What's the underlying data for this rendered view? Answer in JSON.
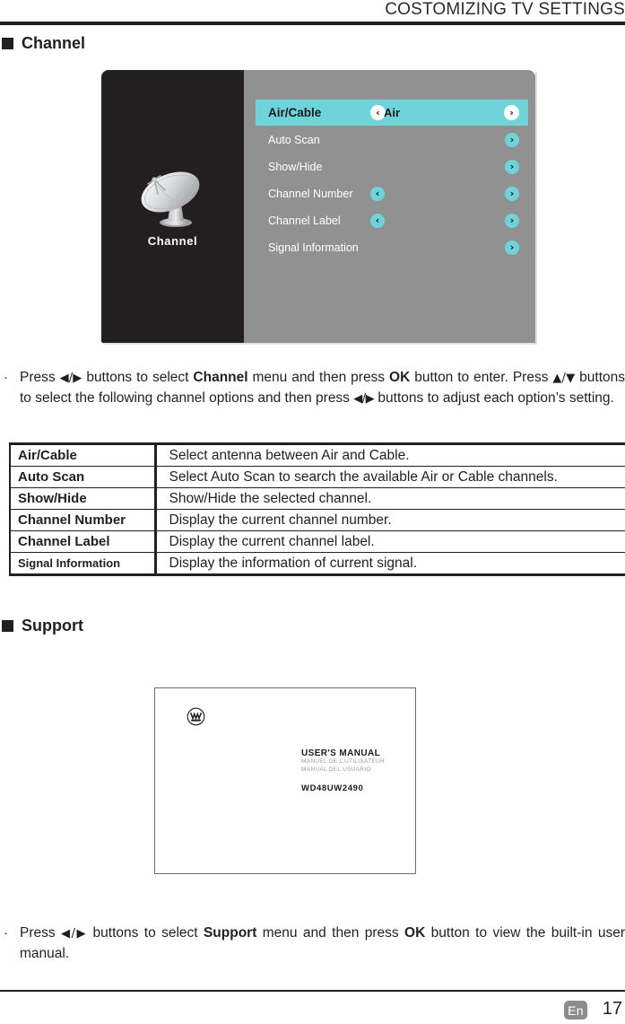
{
  "header": {
    "title": "COSTOMIZING TV SETTINGS"
  },
  "sections": [
    {
      "label": "Channel"
    },
    {
      "label": "Support"
    }
  ],
  "osd": {
    "icon": "satellite-dish-icon",
    "icon_caption": "Channel",
    "panel_bg": "#919191",
    "sidebar_bg": "#231f20",
    "highlight_color": "#6fd3da",
    "rows": [
      {
        "label": "Air/Cable",
        "value": "Air",
        "selected": true,
        "left_arrow": "‹",
        "right_arrow": "›",
        "has_left": true,
        "has_right": true
      },
      {
        "label": "Auto Scan",
        "value": "",
        "selected": false,
        "left_arrow": "",
        "right_arrow": "›",
        "has_left": false,
        "has_right": true
      },
      {
        "label": "Show/Hide",
        "value": "",
        "selected": false,
        "left_arrow": "",
        "right_arrow": "›",
        "has_left": false,
        "has_right": true
      },
      {
        "label": "Channel Number",
        "value": "",
        "selected": false,
        "left_arrow": "‹",
        "right_arrow": "›",
        "has_left": true,
        "has_right": true
      },
      {
        "label": "Channel Label",
        "value": "",
        "selected": false,
        "left_arrow": "‹",
        "right_arrow": "›",
        "has_left": true,
        "has_right": true
      },
      {
        "label": "Signal Information",
        "value": "",
        "selected": false,
        "left_arrow": "",
        "right_arrow": "›",
        "has_left": false,
        "has_right": true
      }
    ]
  },
  "channel_instruction": {
    "bullet": "·",
    "part1": "Press ",
    "nav_lr_1": "◀/▶",
    "part2": " buttons to select ",
    "bold1": "Channel",
    "part3": " menu and then press ",
    "bold2": "OK",
    "part4": " button to enter. Press ",
    "nav_ud": "▲/▼",
    "part5": " buttons to select the following channel options and then press ",
    "nav_lr_2": "◀/▶",
    "part6": " buttons to adjust each option’s setting."
  },
  "spec_table": {
    "rows": [
      {
        "term": "Air/Cable",
        "term_small": false,
        "desc": "Select antenna between Air and Cable.",
        "multiline": false
      },
      {
        "term": "Auto Scan",
        "term_small": false,
        "desc": "Select Auto Scan to search the available Air or Cable channels.",
        "multiline": true
      },
      {
        "term": "Show/Hide",
        "term_small": false,
        "desc": "Show/Hide the selected channel.",
        "multiline": false
      },
      {
        "term": "Channel Number",
        "term_small": false,
        "desc": "Display the current channel number.",
        "multiline": false
      },
      {
        "term": "Channel Label",
        "term_small": false,
        "desc": "Display the current channel label.",
        "multiline": false
      },
      {
        "term": "Signal Information",
        "term_small": true,
        "desc": "Display the information of current signal.",
        "multiline": false
      }
    ]
  },
  "manual_cover": {
    "logo": "westinghouse-w-logo",
    "title_en": "USER'S MANUAL",
    "title_fr": "MANUEL DE L'UTILISATEUR",
    "title_es": "MANUAL DEL USUARIO",
    "model": "WD48UW2490"
  },
  "support_instruction": {
    "bullet": "·",
    "part1": "Press ",
    "nav_lr": "◀/▶",
    "part2": " buttons to select ",
    "bold1": "Support",
    "part3": " menu and then press ",
    "bold2": "OK",
    "part4": " button to view the built-in user manual."
  },
  "footer": {
    "language": "En",
    "page_number": "17"
  }
}
